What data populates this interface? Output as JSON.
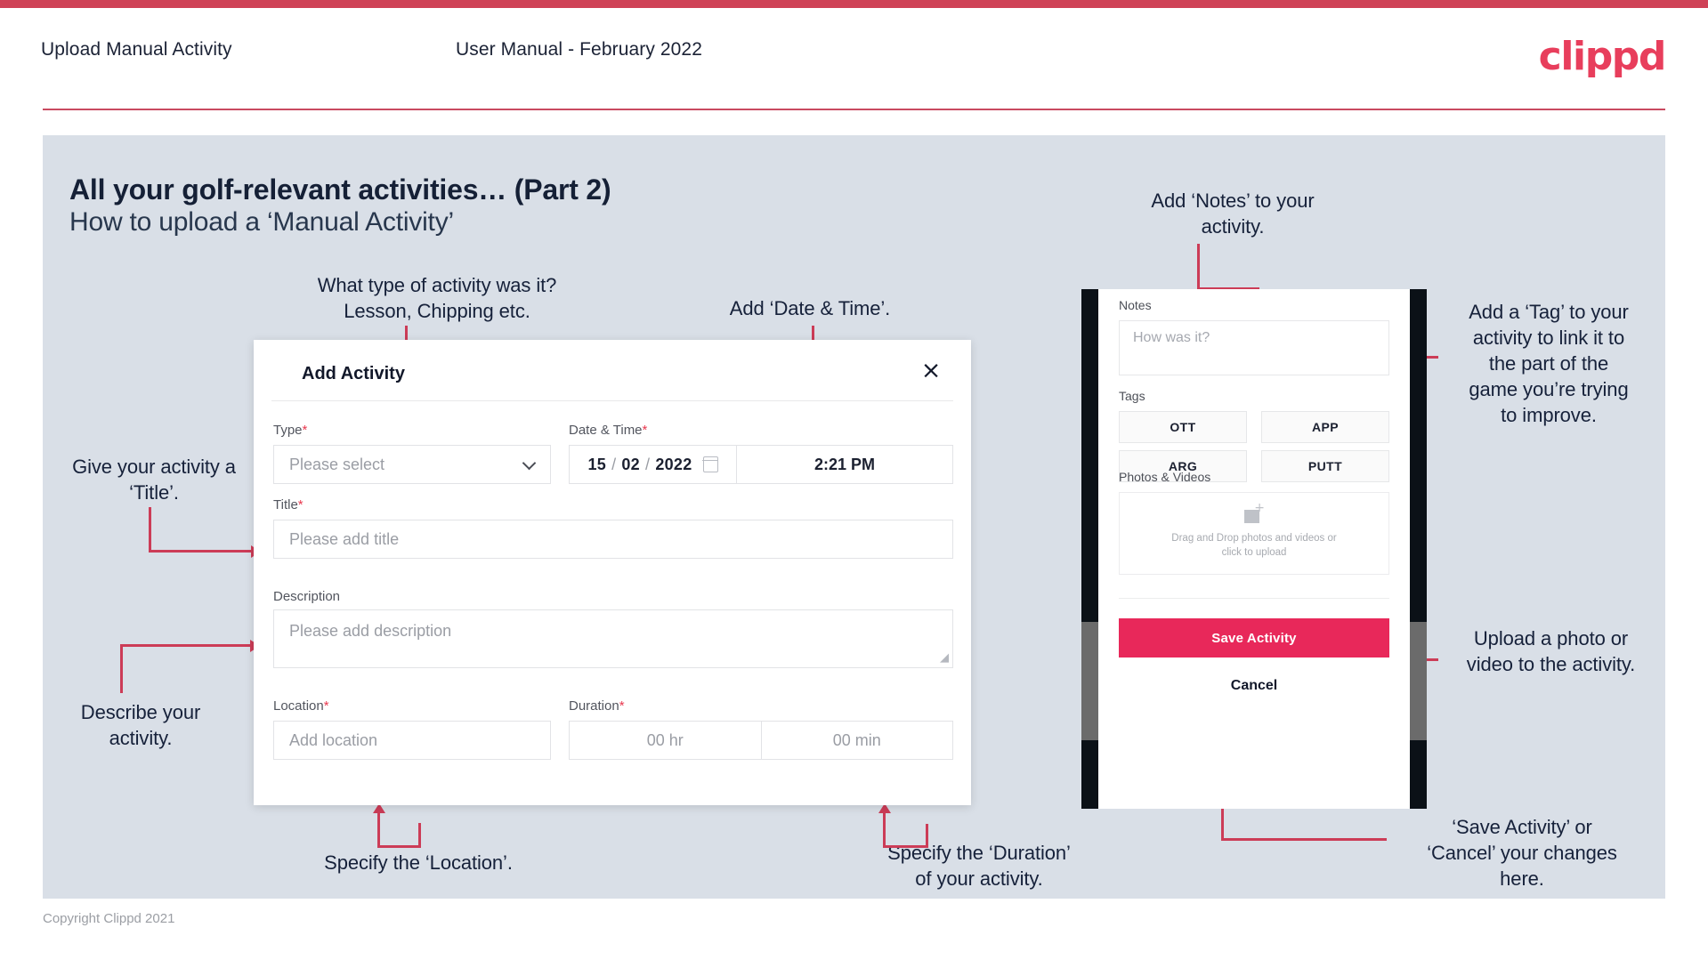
{
  "header": {
    "title": "Upload Manual Activity",
    "subtitle": "User Manual - February 2022",
    "logo": "clippd"
  },
  "slide": {
    "title": "All your golf-relevant activities… (Part 2)",
    "subtitle": "How to upload a ‘Manual Activity’"
  },
  "annotations": {
    "type": "What type of activity was it?\nLesson, Chipping etc.",
    "datetime": "Add ‘Date & Time’.",
    "title": "Give your activity a\n‘Title’.",
    "description": "Describe your\nactivity.",
    "location": "Specify the ‘Location’.",
    "duration": "Specify the ‘Duration’\nof your activity.",
    "notes": "Add ‘Notes’ to your\nactivity.",
    "tag": "Add a ‘Tag’ to your\nactivity to link it to\nthe part of the\ngame you’re trying\nto improve.",
    "photo": "Upload a photo or\nvideo to the activity.",
    "save": "‘Save Activity’ or\n‘Cancel’ your changes\nhere."
  },
  "dialog": {
    "title": "Add Activity",
    "close_icon": "×",
    "fields": {
      "type": {
        "label": "Type",
        "required": "*",
        "placeholder": "Please select"
      },
      "datetime": {
        "label": "Date & Time",
        "required": "*",
        "day": "15",
        "month": "02",
        "year": "2022",
        "sep": "/",
        "time": "2:21 PM"
      },
      "title": {
        "label": "Title",
        "required": "*",
        "placeholder": "Please add title"
      },
      "description": {
        "label": "Description",
        "placeholder": "Please add description"
      },
      "location": {
        "label": "Location",
        "required": "*",
        "placeholder": "Add location"
      },
      "duration": {
        "label": "Duration",
        "required": "*",
        "hours": "00 hr",
        "minutes": "00 min"
      }
    }
  },
  "phone": {
    "notes": {
      "label": "Notes",
      "placeholder": "How was it?"
    },
    "tags": {
      "label": "Tags",
      "items": [
        "OTT",
        "APP",
        "ARG",
        "PUTT"
      ]
    },
    "photos": {
      "label": "Photos & Videos",
      "drop_line1": "Drag and Drop photos and videos or",
      "drop_line2": "click to upload"
    },
    "save_label": "Save Activity",
    "cancel_label": "Cancel"
  },
  "footer": {
    "copyright": "Copyright Clippd 2021"
  },
  "colors": {
    "accent": "#e8285a",
    "brand_red": "#cf4257",
    "connector": "#cc3c57",
    "slide_bg": "#d9dfe7",
    "text_dark": "#16213a"
  }
}
